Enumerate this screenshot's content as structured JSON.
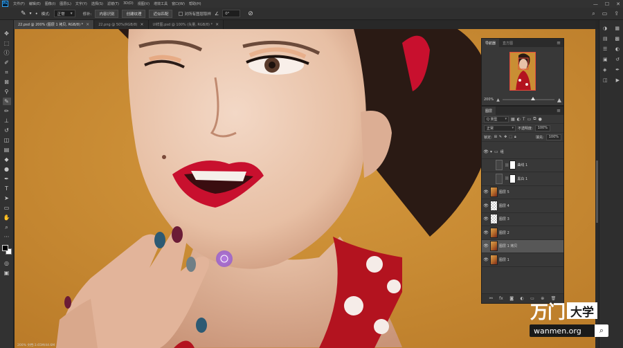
{
  "app": {
    "logo": "Ps"
  },
  "menu": [
    "文件(F)",
    "编辑(E)",
    "图像(I)",
    "图层(L)",
    "文字(Y)",
    "选择(S)",
    "滤镜(T)",
    "3D(D)",
    "视图(V)",
    "增效工具",
    "窗口(W)",
    "帮助(H)"
  ],
  "window_controls": {
    "minimize": "—",
    "maximize": "☐",
    "close": "✕"
  },
  "options": {
    "tool_icon": "patch-icon",
    "mode_label": "模式:",
    "mode_value": "正常",
    "source_label": "修补:",
    "btn_content_aware": "内容识别",
    "btn_create_texture": "创建纹理",
    "btn_proximity": "近似匹配",
    "sample_all_label": "对所有图层取样",
    "angle_value": "0°",
    "right_icons": [
      "search-icon",
      "workspace-icon",
      "share-icon"
    ]
  },
  "tabs": [
    {
      "label": "22.psd @ 200% (图层 1 拷贝, RGB/8) *",
      "active": true
    },
    {
      "label": "22.png @ 50%(RGB/8)",
      "active": false
    },
    {
      "label": "UI样图.psd @ 100% (矢量, RGB/8) *",
      "active": false
    }
  ],
  "tools": [
    "move-icon",
    "marquee-icon",
    "lasso-icon",
    "quick-select-icon",
    "crop-icon",
    "frame-icon",
    "eyedropper-icon",
    "patch-icon",
    "brush-icon",
    "stamp-icon",
    "history-brush-icon",
    "eraser-icon",
    "gradient-icon",
    "blur-icon",
    "dodge-icon",
    "pen-icon",
    "type-icon",
    "path-select-icon",
    "rectangle-icon",
    "hand-icon",
    "zoom-icon",
    "more-icon"
  ],
  "navigator": {
    "tabs": [
      "导航器",
      "直方图"
    ],
    "zoom": "200%"
  },
  "layers": {
    "tab": "图层",
    "filter_label": "Q 类型",
    "blend_mode": "正常",
    "opacity_label": "不透明度:",
    "opacity_value": "100%",
    "lock_label": "锁定:",
    "fill_label": "填充:",
    "fill_value": "100%",
    "items": [
      {
        "name": "组",
        "kind": "group",
        "visible": true,
        "indent": false
      },
      {
        "name": "曲线 1",
        "kind": "adjustment",
        "visible": false,
        "indent": true
      },
      {
        "name": "黑白 1",
        "kind": "adjustment",
        "visible": false,
        "indent": true
      },
      {
        "name": "图层 5",
        "kind": "photo",
        "visible": true,
        "indent": false
      },
      {
        "name": "图层 4",
        "kind": "transparent",
        "visible": true,
        "indent": false
      },
      {
        "name": "图层 3",
        "kind": "transparent",
        "visible": true,
        "indent": false
      },
      {
        "name": "图层 2",
        "kind": "photo",
        "visible": true,
        "indent": false
      },
      {
        "name": "图层 1 拷贝",
        "kind": "photo",
        "visible": true,
        "indent": false
      },
      {
        "name": "图层 1",
        "kind": "photo",
        "visible": true,
        "indent": false
      }
    ],
    "bottom_icons": [
      "link-icon",
      "fx-icon",
      "mask-icon",
      "adjustment-icon",
      "folder-icon",
      "new-layer-icon",
      "trash-icon"
    ]
  },
  "watermark": {
    "brand_left": "万门",
    "brand_box": "大学",
    "url": "wanmen.org"
  },
  "status": "200%   文档:3.65M/44.6M",
  "colors": {
    "background": "#c98e34",
    "accent": "#31a8ff",
    "lips": "#c8102e",
    "dress": "#b3131f",
    "brush_cursor": "#9b59e0"
  }
}
